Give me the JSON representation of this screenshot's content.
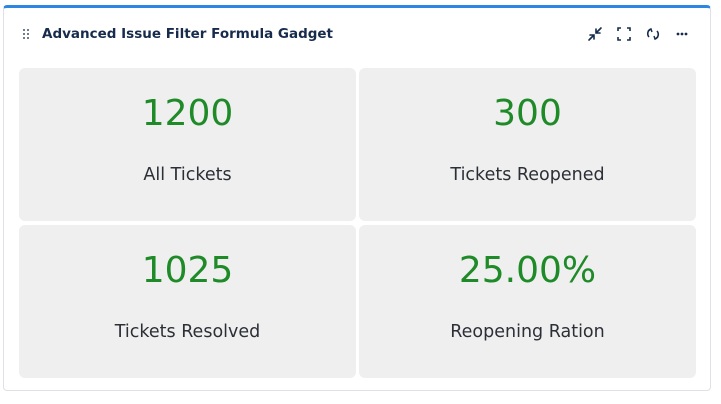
{
  "gadget": {
    "title": "Advanced Issue Filter Formula Gadget",
    "actions": [
      {
        "icon": "minimize-icon"
      },
      {
        "icon": "fullscreen-icon"
      },
      {
        "icon": "refresh-icon"
      },
      {
        "icon": "more-icon"
      }
    ]
  },
  "tiles": [
    {
      "value": "1200",
      "label": "All Tickets"
    },
    {
      "value": "300",
      "label": "Tickets Reopened"
    },
    {
      "value": "1025",
      "label": "Tickets Resolved"
    },
    {
      "value": "25.00%",
      "label": "Reopening Ration"
    }
  ],
  "colors": {
    "accent_top_border": "#2d86e0",
    "value_green": "#1e8a28",
    "tile_background": "#efefef",
    "title_text": "#172b4d"
  }
}
